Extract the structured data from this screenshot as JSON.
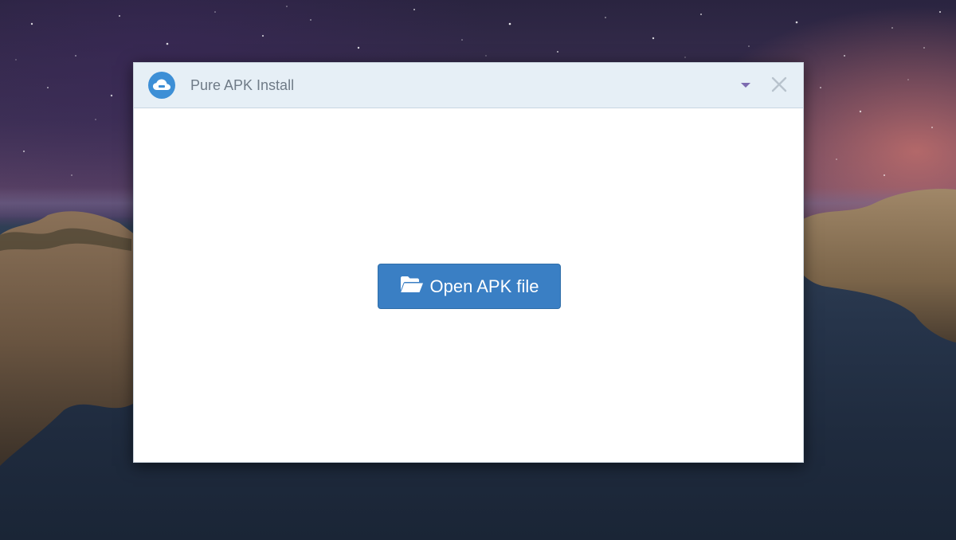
{
  "window": {
    "title": "Pure APK Install",
    "app_icon": "cloud-icon",
    "menu_icon": "caret-down-icon",
    "close_icon": "close-icon"
  },
  "main": {
    "open_button": {
      "label": "Open APK file",
      "icon": "folder-open-icon"
    }
  },
  "colors": {
    "accent": "#3a7fc4",
    "titlebar": "#e6eff6",
    "title_text": "#6f7b87"
  }
}
